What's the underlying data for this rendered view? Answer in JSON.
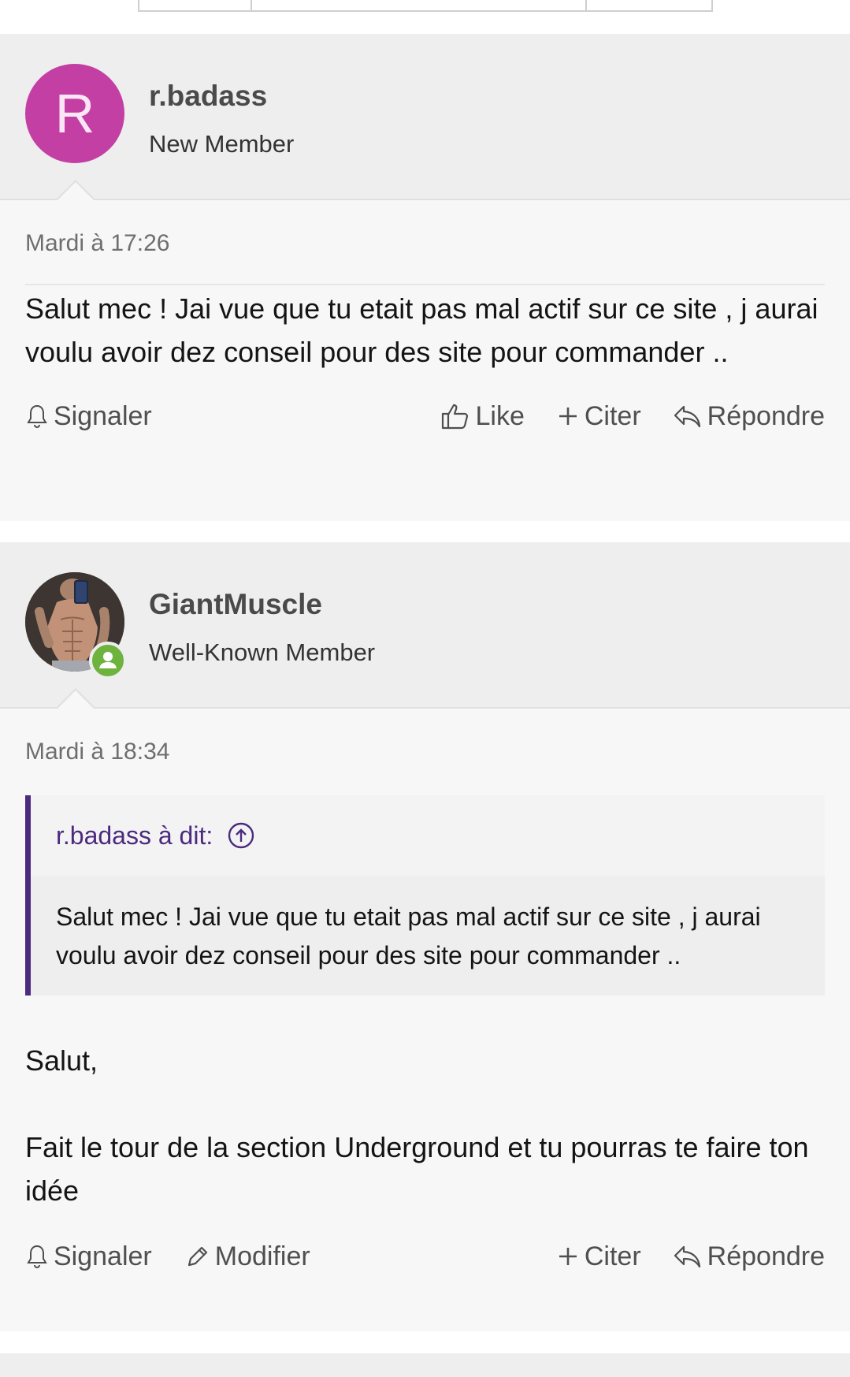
{
  "posts": [
    {
      "username": "r.badass",
      "role": "New Member",
      "avatar_letter": "R",
      "avatar_color": "#c33fa4",
      "timestamp": "Mardi à 17:26",
      "message": "Salut mec ! Jai vue que tu etait pas mal actif sur ce site , j aurai voulu avoir dez conseil pour des site pour commander ..",
      "actions": {
        "report": "Signaler",
        "like": "Like",
        "quote": "Citer",
        "reply": "Répondre"
      }
    },
    {
      "username": "GiantMuscle",
      "role": "Well-Known Member",
      "avatar_icon": "user-photo",
      "online": true,
      "online_color": "#6fb33f",
      "timestamp": "Mardi à 18:34",
      "quote": {
        "author_line": "r.badass à dit:",
        "text": "Salut mec ! Jai vue que tu etait pas mal actif sur ce site , j aurai voulu avoir dez conseil pour des site pour commander ..",
        "accent": "#4b2a7f"
      },
      "paragraphs": [
        "Salut,",
        "Fait le tour de la section Underground et tu pourras te faire ton idée"
      ],
      "actions": {
        "report": "Signaler",
        "edit": "Modifier",
        "quote": "Citer",
        "reply": "Répondre"
      }
    }
  ]
}
